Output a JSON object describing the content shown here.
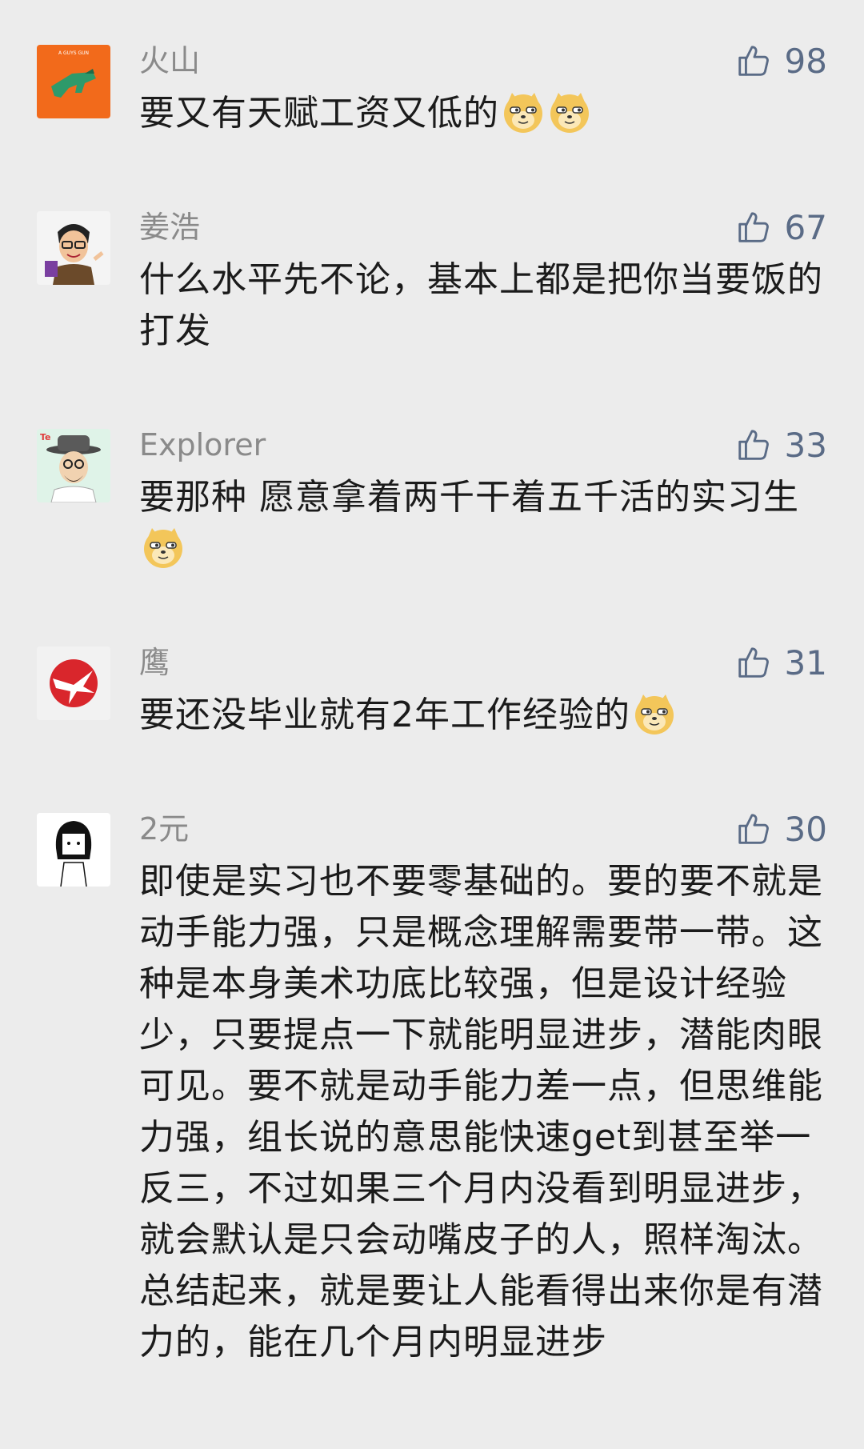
{
  "comments": [
    {
      "name": "火山",
      "likes": "98",
      "text": "要又有天赋工资又低的",
      "avatar_text": "A GUYS GUN"
    },
    {
      "name": "姜浩",
      "likes": "67",
      "text": "什么水平先不论，基本上都是把你当要饭的打发"
    },
    {
      "name": "Explorer",
      "likes": "33",
      "text": "要那种 愿意拿着两千干着五千活的实习生"
    },
    {
      "name": "鹰",
      "likes": "31",
      "text": "要还没毕业就有2年工作经验的"
    },
    {
      "name": "2元",
      "likes": "30",
      "text": "即使是实习也不要零基础的。要的要不就是动手能力强，只是概念理解需要带一带。这种是本身美术功底比较强，但是设计经验少，只要提点一下就能明显进步，潜能肉眼可见。要不就是动手能力差一点，但思维能力强，组长说的意思能快速get到甚至举一反三，不过如果三个月内没看到明显进步，就会默认是只会动嘴皮子的人，照样淘汰。总结起来，就是要让人能看得出来你是有潜力的，能在几个月内明显进步"
    }
  ],
  "icons": {
    "like": "thumbs-up-icon",
    "emoji": "doge-emoji-icon"
  },
  "colors": {
    "background": "#ececec",
    "name": "#8a8a8a",
    "like": "#5a6b86",
    "text": "#1b1b1b"
  }
}
